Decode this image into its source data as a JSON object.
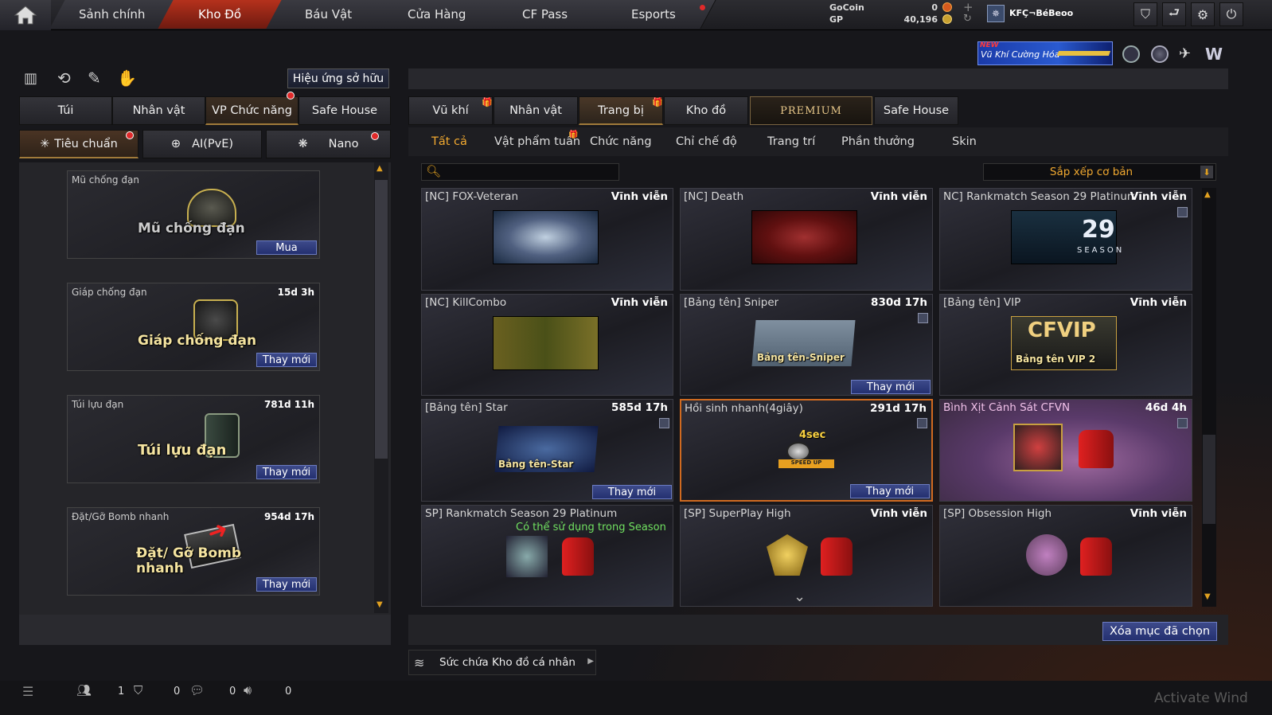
{
  "nav": {
    "tabs": [
      "Sảnh chính",
      "Kho Đồ",
      "Báu Vật",
      "Cửa Hàng",
      "CF Pass",
      "Esports"
    ],
    "active": "Kho Đồ"
  },
  "currency": {
    "gocoin_label": "GoCoin",
    "gocoin_value": "0",
    "gp_label": "GP",
    "gp_value": "40,196"
  },
  "user": {
    "name": "KFÇ¬BéBeoo"
  },
  "banner": {
    "new": "NEW",
    "text": "Vũ Khí Cường Hóa"
  },
  "left": {
    "effects_button": "Hiệu ứng sở hữu",
    "tabs": [
      "Túi",
      "Nhân vật",
      "VP Chức năng",
      "Safe House"
    ],
    "modes": [
      "Tiêu chuẩn",
      "AI(PvE)",
      "Nano"
    ],
    "items": [
      {
        "title": "Mũ chống đạn",
        "duration": "",
        "overlay": "Mũ chống đạn",
        "button": "Mua"
      },
      {
        "title": "Giáp chống đạn",
        "duration": "15d 3h",
        "overlay": "Giáp chống đạn",
        "button": "Thay mới"
      },
      {
        "title": "Túi lựu đạn",
        "duration": "781d 11h",
        "overlay": "Túi lựu đạn",
        "button": "Thay mới"
      },
      {
        "title": "Đặt/Gỡ Bomb nhanh",
        "duration": "954d 17h",
        "overlay": "Đặt/ Gỡ Bomb nhanh",
        "button": "Thay mới"
      }
    ]
  },
  "right": {
    "tabs": [
      "Vũ khí",
      "Nhân vật",
      "Trang bị",
      "Kho đồ",
      "PREMIUM",
      "Safe House"
    ],
    "subtabs": [
      "Tất cả",
      "Vật phẩm tuần",
      "Chức năng",
      "Chỉ chế độ",
      "Trang trí",
      "Phần thưởng",
      "Skin"
    ],
    "search_placeholder": "",
    "sort": "Sắp xếp cơ bản",
    "items": [
      {
        "title": "[NC] FOX-Veteran",
        "duration": "Vĩnh viễn"
      },
      {
        "title": "[NC] Death",
        "duration": "Vĩnh viễn"
      },
      {
        "title": "NC] Rankmatch Season 29 Platinum",
        "duration": "Vĩnh viễn",
        "img_text": "29",
        "img_sub": "SEASON"
      },
      {
        "title": "[NC] KillCombo",
        "duration": "Vĩnh viễn"
      },
      {
        "title": "[Bảng tên] Sniper",
        "duration": "830d 17h",
        "overlay": "Bảng tên-Sniper",
        "button": "Thay mới"
      },
      {
        "title": "[Bảng tên] VIP",
        "duration": "Vĩnh viễn",
        "overlay": "Bảng tên VIP 2",
        "img_text": "CFVIP"
      },
      {
        "title": "[Bảng tên] Star",
        "duration": "585d 17h",
        "overlay": "Bảng tên-Star",
        "button": "Thay mới"
      },
      {
        "title": "Hồi sinh nhanh(4giây)",
        "duration": "291d 17h",
        "img_text": "4sec",
        "img_sub": "SPEED UP",
        "button": "Thay mới"
      },
      {
        "title": "Bình Xịt Cảnh Sát CFVN",
        "duration": "46d 4h"
      },
      {
        "title": "SP] Rankmatch Season 29 Platinum",
        "duration": "",
        "note": "Có thể sử dụng trong Season"
      },
      {
        "title": "[SP] SuperPlay High",
        "duration": "Vĩnh viễn"
      },
      {
        "title": "[SP] Obsession High",
        "duration": "Vĩnh viễn"
      }
    ],
    "delete_button": "Xóa mục đã chọn",
    "capacity": "Sức chứa Kho đồ cá nhân"
  },
  "status": {
    "friends": "1",
    "clan": "0",
    "chat": "0",
    "voice": "0"
  },
  "watermark": "Activate Wind",
  "colors": {
    "accent": "#b5311c",
    "highlight": "#f0a830",
    "button": "#2f3c80"
  }
}
